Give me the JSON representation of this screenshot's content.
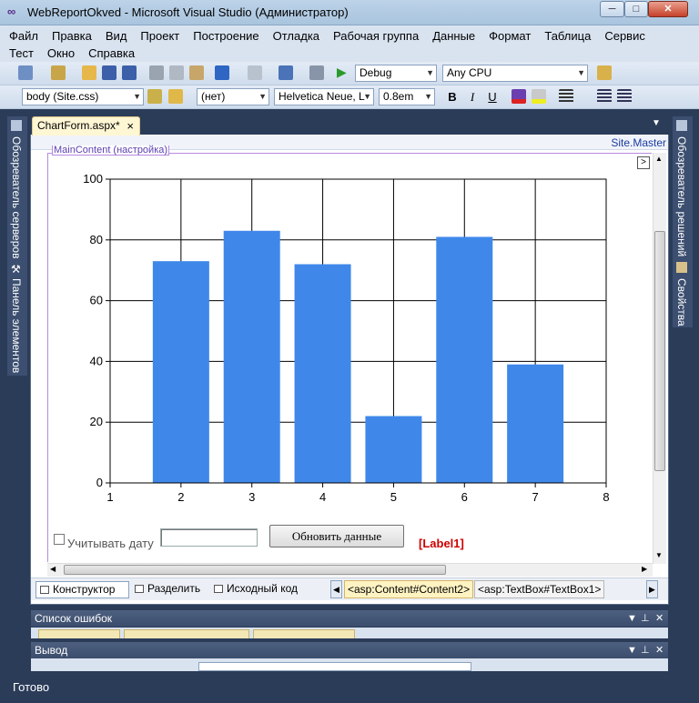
{
  "window": {
    "title": "WebReportOkved - Microsoft Visual Studio (Администратор)",
    "min": "─",
    "max": "□",
    "close": "✕"
  },
  "menu": [
    "Файл",
    "Правка",
    "Вид",
    "Проект",
    "Построение",
    "Отладка",
    "Рабочая группа",
    "Данные",
    "Формат",
    "Таблица",
    "Сервис",
    "Тест",
    "Окно",
    "Справка"
  ],
  "toolbar1": {
    "config": "Debug",
    "platform": "Any CPU"
  },
  "toolbar2": {
    "target_rule": "body (Site.css)",
    "block_format": "(нет)",
    "font_name": "Helvetica Neue, L",
    "font_size": "0.8em",
    "bold": "B",
    "italic": "I",
    "underline": "U"
  },
  "side_left": {
    "server_explorer": "Обозреватель серверов",
    "toolbox": "Панель элементов"
  },
  "side_right": {
    "solution_explorer": "Обозреватель решений",
    "properties": "Свойства"
  },
  "editor": {
    "doc_tab": "ChartForm.aspx*",
    "doc_tab_close": "×",
    "master_label": "Site.Master",
    "content_label": "MainContent (настройка)",
    "smart_tag": ">"
  },
  "form": {
    "checkbox_label": "Учитывать дату",
    "textbox_value": "",
    "refresh_button": "Обновить данные",
    "label": "[Label1]"
  },
  "view_buttons": {
    "design": "Конструктор",
    "split": "Разделить",
    "source": "Исходный код"
  },
  "tag_nav": {
    "tag1": "<asp:Content#Content2>",
    "tag2": "<asp:TextBox#TextBox1>"
  },
  "panels": {
    "error_list": "Список ошибок",
    "output": "Вывод"
  },
  "status": {
    "text": "Готово"
  },
  "colors": {
    "bar": "#3f88ea",
    "accent": "#2b3c59"
  },
  "chart_data": {
    "type": "bar",
    "x": [
      2,
      3,
      4,
      5,
      6,
      7
    ],
    "values": [
      73,
      83,
      72,
      22,
      81,
      39
    ],
    "xlim": [
      1,
      8
    ],
    "ylim": [
      0,
      100
    ],
    "xticks": [
      1,
      2,
      3,
      4,
      5,
      6,
      7,
      8
    ],
    "yticks": [
      0,
      20,
      40,
      60,
      80,
      100
    ],
    "grid": true,
    "title": "",
    "xlabel": "",
    "ylabel": ""
  }
}
